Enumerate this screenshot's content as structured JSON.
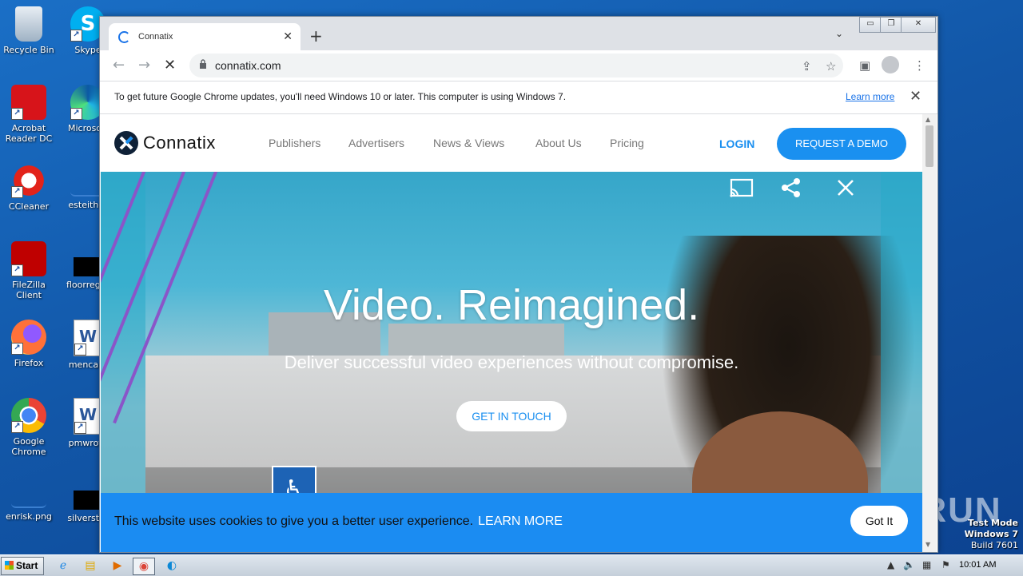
{
  "desktop": {
    "icons_col1": [
      {
        "label": "Recycle Bin",
        "icon": "recycle-bin-icon"
      },
      {
        "label": "Acrobat Reader DC",
        "icon": "acrobat-icon"
      },
      {
        "label": "CCleaner",
        "icon": "ccleaner-icon"
      },
      {
        "label": "FileZilla Client",
        "icon": "filezilla-icon"
      },
      {
        "label": "Firefox",
        "icon": "firefox-icon"
      },
      {
        "label": "Google Chrome",
        "icon": "chrome-icon"
      },
      {
        "label": "enrisk.png",
        "icon": "image-file-icon"
      }
    ],
    "icons_col2": [
      {
        "label": "Skype",
        "icon": "skype-icon"
      },
      {
        "label": "Microsoft",
        "icon": "edge-icon"
      },
      {
        "label": "esteither",
        "icon": "file-icon"
      },
      {
        "label": "floorregar",
        "icon": "file-icon"
      },
      {
        "label": "mencare",
        "icon": "word-doc-icon"
      },
      {
        "label": "pmwrote",
        "icon": "word-doc-icon"
      },
      {
        "label": "silverstru",
        "icon": "file-icon"
      }
    ],
    "watermark": {
      "line1": "Test Mode",
      "line2": "Windows 7",
      "line3": "Build 7601"
    },
    "anyrun": "ANY RUN"
  },
  "browser": {
    "tab_title": "Connatix",
    "url": "connatix.com",
    "infobar": {
      "message": "To get future Google Chrome updates, you'll need Windows 10 or later. This computer is using Windows 7.",
      "learn_more": "Learn more"
    }
  },
  "site": {
    "logo_text": "Connatix",
    "nav": [
      "Publishers",
      "Advertisers",
      "News & Views",
      "About Us",
      "Pricing"
    ],
    "login": "LOGIN",
    "demo": "REQUEST A DEMO",
    "hero_title": "Video. Reimagined.",
    "hero_sub": "Deliver successful video experiences without compromise.",
    "cta": "GET IN TOUCH",
    "cookie": {
      "text": "This website uses cookies to give you a better user experience.",
      "learn_more": "LEARN MORE",
      "accept": "Got It"
    }
  },
  "taskbar": {
    "start": "Start",
    "clock": "10:01 AM"
  },
  "colors": {
    "accent": "#1a8ff0",
    "cookie_bg": "#1b8cf2",
    "desktop": "#1257a8"
  }
}
